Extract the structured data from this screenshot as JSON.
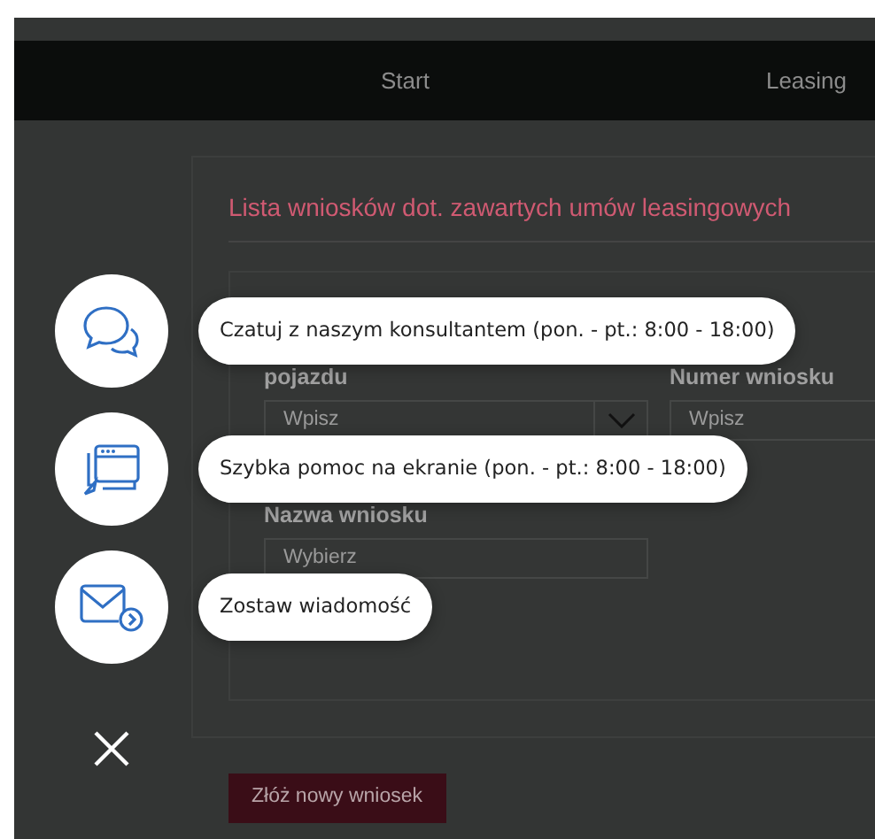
{
  "navbar": {
    "items": [
      {
        "label": "Start"
      },
      {
        "label": "Leasing"
      }
    ]
  },
  "card": {
    "title": "Lista wniosków dot. zawartych umów leasingowych",
    "fields": [
      {
        "label": "pojazdu",
        "placeholder": "Wpisz",
        "kind": "select"
      },
      {
        "label": "Numer wniosku",
        "placeholder": "Wpisz",
        "kind": "text"
      },
      {
        "label": "Nazwa wniosku",
        "placeholder": "Wybierz",
        "kind": "text"
      }
    ],
    "button": "Złóż nowy wniosek"
  },
  "contact_menu": {
    "items": [
      {
        "kind": "chat",
        "label": "Czatuj z naszym konsultantem (pon. - pt.: 8:00 - 18:00)"
      },
      {
        "kind": "screen",
        "label": "Szybka pomoc na ekranie (pon. - pt.: 8:00 - 18:00)"
      },
      {
        "kind": "mail",
        "label": "Zostaw wiadomość"
      }
    ]
  }
}
